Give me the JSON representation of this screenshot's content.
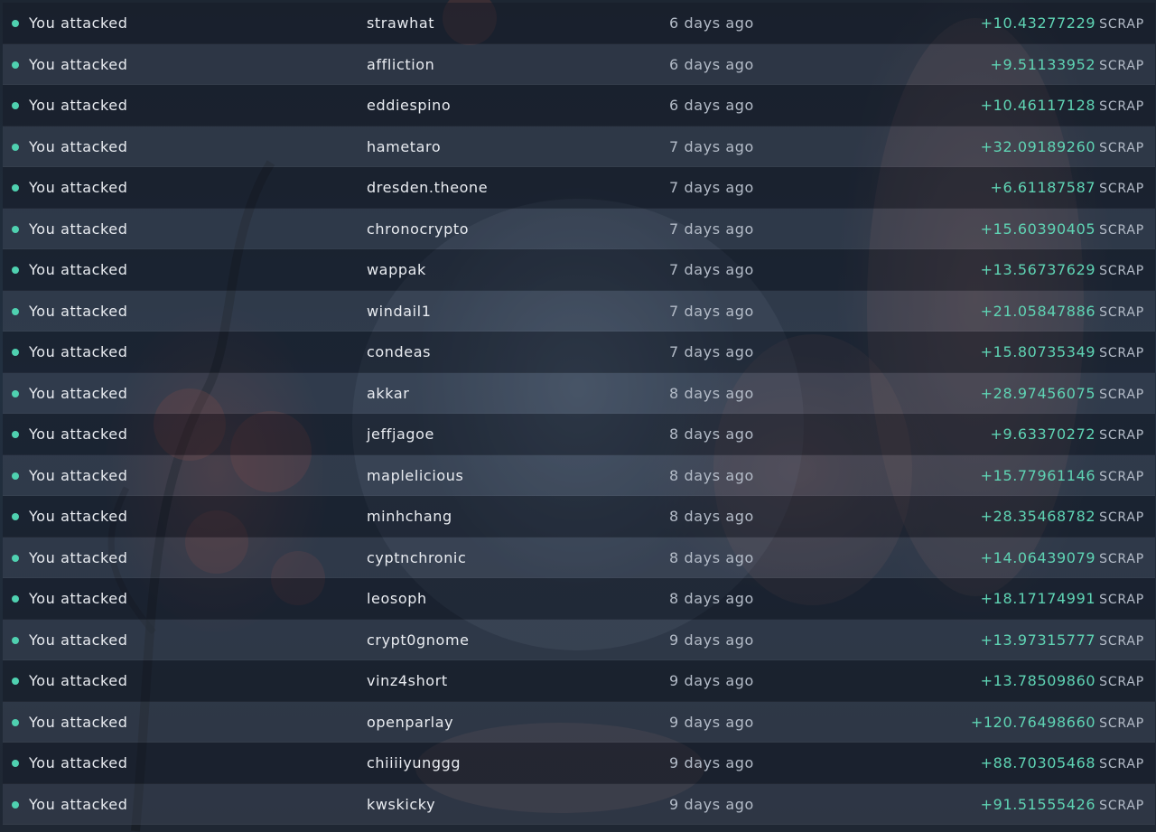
{
  "accent_color": "#5fd4b4",
  "status_dot_color": "#4fd1b0",
  "rows": [
    {
      "action": "You attacked",
      "player": "strawhat",
      "time": "6 days ago",
      "amount": "+10.43277229",
      "unit": "SCRAP"
    },
    {
      "action": "You attacked",
      "player": "affliction",
      "time": "6 days ago",
      "amount": "+9.51133952",
      "unit": "SCRAP"
    },
    {
      "action": "You attacked",
      "player": "eddiespino",
      "time": "6 days ago",
      "amount": "+10.46117128",
      "unit": "SCRAP"
    },
    {
      "action": "You attacked",
      "player": "hametaro",
      "time": "7 days ago",
      "amount": "+32.09189260",
      "unit": "SCRAP"
    },
    {
      "action": "You attacked",
      "player": "dresden.theone",
      "time": "7 days ago",
      "amount": "+6.61187587",
      "unit": "SCRAP"
    },
    {
      "action": "You attacked",
      "player": "chronocrypto",
      "time": "7 days ago",
      "amount": "+15.60390405",
      "unit": "SCRAP"
    },
    {
      "action": "You attacked",
      "player": "wappak",
      "time": "7 days ago",
      "amount": "+13.56737629",
      "unit": "SCRAP"
    },
    {
      "action": "You attacked",
      "player": "windail1",
      "time": "7 days ago",
      "amount": "+21.05847886",
      "unit": "SCRAP"
    },
    {
      "action": "You attacked",
      "player": "condeas",
      "time": "7 days ago",
      "amount": "+15.80735349",
      "unit": "SCRAP"
    },
    {
      "action": "You attacked",
      "player": "akkar",
      "time": "8 days ago",
      "amount": "+28.97456075",
      "unit": "SCRAP"
    },
    {
      "action": "You attacked",
      "player": "jeffjagoe",
      "time": "8 days ago",
      "amount": "+9.63370272",
      "unit": "SCRAP"
    },
    {
      "action": "You attacked",
      "player": "maplelicious",
      "time": "8 days ago",
      "amount": "+15.77961146",
      "unit": "SCRAP"
    },
    {
      "action": "You attacked",
      "player": "minhchang",
      "time": "8 days ago",
      "amount": "+28.35468782",
      "unit": "SCRAP"
    },
    {
      "action": "You attacked",
      "player": "cyptnchronic",
      "time": "8 days ago",
      "amount": "+14.06439079",
      "unit": "SCRAP"
    },
    {
      "action": "You attacked",
      "player": "leosoph",
      "time": "8 days ago",
      "amount": "+18.17174991",
      "unit": "SCRAP"
    },
    {
      "action": "You attacked",
      "player": "crypt0gnome",
      "time": "9 days ago",
      "amount": "+13.97315777",
      "unit": "SCRAP"
    },
    {
      "action": "You attacked",
      "player": "vinz4short",
      "time": "9 days ago",
      "amount": "+13.78509860",
      "unit": "SCRAP"
    },
    {
      "action": "You attacked",
      "player": "openparlay",
      "time": "9 days ago",
      "amount": "+120.76498660",
      "unit": "SCRAP"
    },
    {
      "action": "You attacked",
      "player": "chiiiiyunggg",
      "time": "9 days ago",
      "amount": "+88.70305468",
      "unit": "SCRAP"
    },
    {
      "action": "You attacked",
      "player": "kwskicky",
      "time": "9 days ago",
      "amount": "+91.51555426",
      "unit": "SCRAP"
    }
  ]
}
